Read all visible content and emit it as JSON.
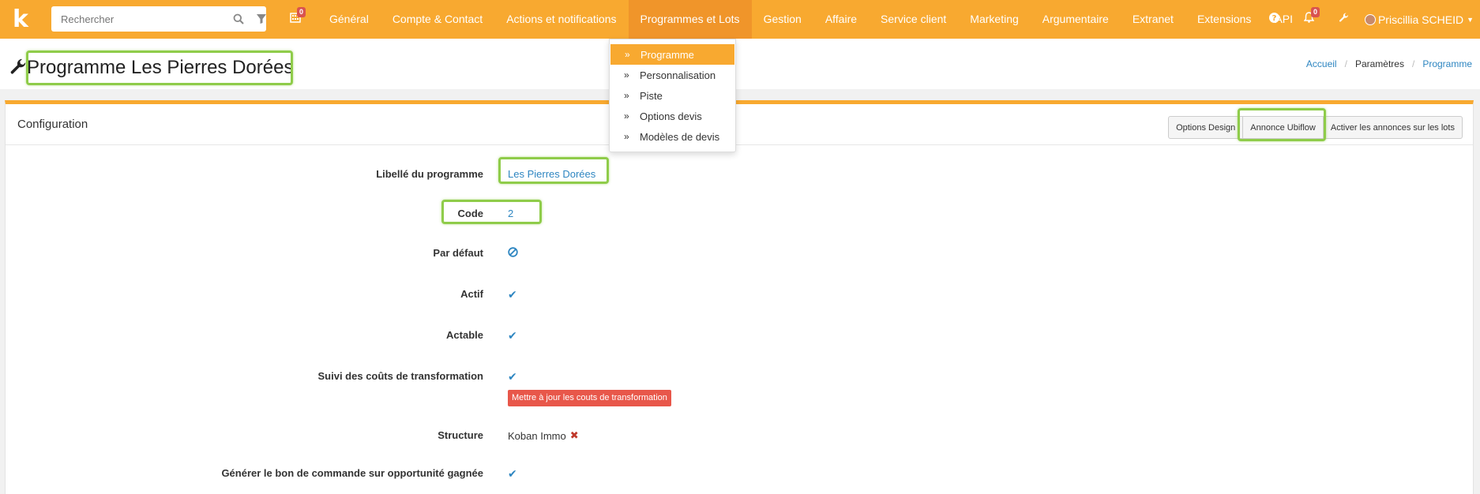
{
  "topbar": {
    "logo": "k",
    "search_placeholder": "Rechercher",
    "cal_badge": "0",
    "nav_items": [
      "Général",
      "Compte & Contact",
      "Actions et notifications",
      "Programmes et Lots",
      "Gestion",
      "Affaire",
      "Service client",
      "Marketing",
      "Argumentaire",
      "Extranet",
      "Extensions",
      "API"
    ],
    "notif_badge": "0",
    "user_name": "Priscillia SCHEID"
  },
  "dropdown": {
    "items": [
      "Programme",
      "Personnalisation",
      "Piste",
      "Options devis",
      "Modèles de devis"
    ]
  },
  "header": {
    "title": "Programme Les Pierres Dorées",
    "breadcrumb": [
      "Accueil",
      "Paramètres",
      "Programme"
    ]
  },
  "panel": {
    "title": "Configuration",
    "buttons": [
      "Options Design",
      "Annonce Ubiflow",
      "Activer les annonces sur les lots"
    ],
    "fields": {
      "libelle_label": "Libellé du programme",
      "libelle_value": "Les Pierres Dorées",
      "code_label": "Code",
      "code_value": "2",
      "defaut_label": "Par défaut",
      "actif_label": "Actif",
      "actable_label": "Actable",
      "suivi_label": "Suivi des coûts de transformation",
      "update_btn": "Mettre à jour les couts de transformation",
      "structure_label": "Structure",
      "structure_value": "Koban Immo",
      "generer_label": "Générer le bon de commande sur opportunité gagnée"
    }
  },
  "colors": {
    "accent": "#f8a930",
    "link": "#2e86c1",
    "danger": "#e8574a",
    "highlight": "#8fcc4a"
  }
}
